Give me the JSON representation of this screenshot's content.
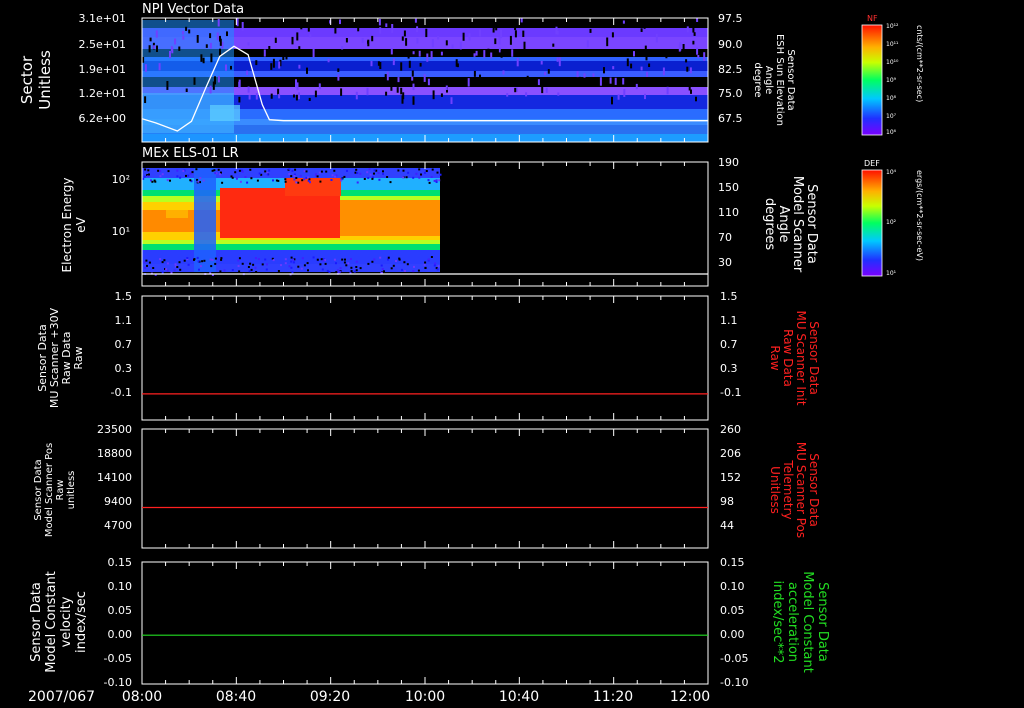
{
  "date_label": "2007/067",
  "time_ticks": [
    "08:00",
    "08:40",
    "09:20",
    "10:00",
    "10:40",
    "11:20",
    "12:00"
  ],
  "chart_data": [
    {
      "id": "npi",
      "type": "heatmap",
      "title": "NPI Vector Data",
      "ylabel_left": [
        "Sector",
        "Unitless"
      ],
      "yticks_left": [
        "3.1e+01",
        "2.5e+01",
        "1.9e+01",
        "1.2e+01",
        "6.2e+00"
      ],
      "ylabel_right": [
        "Sensor Data",
        "ESH Sun Elevation",
        "Angle",
        "degree"
      ],
      "yticks_right": [
        "97.5",
        "90.0",
        "82.5",
        "75.0",
        "67.5"
      ],
      "line_series": {
        "name": "ESH Sun Elevation Angle",
        "x_hours": [
          8.0,
          8.1,
          8.25,
          8.35,
          8.45,
          8.55,
          8.65,
          8.75,
          8.8,
          8.85,
          8.9,
          9.0,
          10.0,
          11.0,
          12.0
        ],
        "y": [
          67.3,
          66.0,
          63.6,
          66.5,
          76.5,
          86.0,
          89.0,
          86.5,
          79.0,
          71.5,
          67.0,
          66.7,
          66.7,
          66.7,
          66.7
        ],
        "color": "#ffffff"
      },
      "colorbar": {
        "label": "NF",
        "units": "cnts/(cm**2-sr-sec)",
        "ticks": [
          "10¹²",
          "10¹¹",
          "10¹⁰",
          "10⁹",
          "10⁸",
          "10⁷",
          "10⁶"
        ]
      }
    },
    {
      "id": "els",
      "type": "heatmap",
      "title": "MEx ELS-01 LR",
      "ylabel_left": [
        "Electron Energy",
        "eV"
      ],
      "yticks_left": [
        "10²",
        "10¹"
      ],
      "ylabel_right": [
        "Sensor Data",
        "Model Scanner",
        "Angle",
        "degrees"
      ],
      "yticks_right": [
        "190",
        "150",
        "110",
        "70",
        "30"
      ],
      "data_end_hour": 10.1,
      "line_series": {
        "name": "Model Scanner Angle",
        "y": 10,
        "color": "#ffffff"
      },
      "colorbar": {
        "label": "DEF",
        "units": "ergs/(cm**2-sr-sec-eV)",
        "ticks": [
          "10⁴",
          "10²",
          "10¹"
        ]
      }
    },
    {
      "id": "mu-raw",
      "type": "line",
      "ylabel_left": [
        "Sensor Data",
        "MU Scanner +30V",
        "Raw Data",
        "Raw"
      ],
      "yticks_left": [
        "1.5",
        "1.1",
        "0.7",
        "0.3",
        "-0.1"
      ],
      "ylabel_right": [
        "Sensor Data",
        "MU Scanner Init",
        "Raw Data",
        "Raw"
      ],
      "yticks_right": [
        "1.5",
        "1.1",
        "0.7",
        "0.3",
        "-0.1"
      ],
      "ylim": [
        -0.4,
        1.5
      ],
      "series": [
        {
          "y": 0.0,
          "color": "#ff2020"
        }
      ]
    },
    {
      "id": "mu-pos",
      "type": "line",
      "ylabel_left": [
        "Sensor Data",
        "Model Scanner Pos",
        "Raw",
        "unitless"
      ],
      "yticks_left": [
        "23500",
        "18800",
        "14100",
        "9400",
        "4700"
      ],
      "ylabel_right": [
        "Sensor Data",
        "MU Scanner Pos",
        "Telemetry",
        "Unitless"
      ],
      "yticks_right": [
        "260",
        "206",
        "152",
        "98",
        "44"
      ],
      "ylim": [
        0,
        23500
      ],
      "series": [
        {
          "y": 8000,
          "color": "#ff2020"
        }
      ]
    },
    {
      "id": "constant",
      "type": "line",
      "ylabel_left": [
        "Sensor Data",
        "Model Constant",
        "velocity",
        "index/sec"
      ],
      "yticks_left": [
        "0.15",
        "0.10",
        "0.05",
        "0.00",
        "-0.05",
        "-0.10"
      ],
      "ylabel_right": [
        "Sensor Data",
        "Model Constant",
        "acceleration",
        "index/sec**2"
      ],
      "yticks_right": [
        "0.15",
        "0.10",
        "0.05",
        "0.00",
        "-0.05",
        "-0.10"
      ],
      "ylim": [
        -0.1,
        0.15
      ],
      "series": [
        {
          "y": 0.0,
          "color": "#22dd22"
        }
      ]
    }
  ],
  "colors": {
    "frame": "#ffffff",
    "right_label_red": "#ff2020",
    "right_label_green": "#22dd22"
  }
}
